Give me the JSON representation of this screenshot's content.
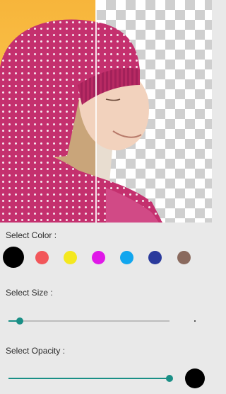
{
  "preview": {
    "original_background": "#f7b53b",
    "cutout_background": "transparent-checkerboard"
  },
  "color_section": {
    "label": "Select Color :",
    "selected_color": "#000000",
    "swatches": [
      {
        "name": "black",
        "hex": "#000000"
      },
      {
        "name": "red",
        "hex": "#f2565a"
      },
      {
        "name": "yellow",
        "hex": "#f4e81f"
      },
      {
        "name": "magenta",
        "hex": "#e018e8"
      },
      {
        "name": "sky-blue",
        "hex": "#12a6ee"
      },
      {
        "name": "indigo",
        "hex": "#2a3a9c"
      },
      {
        "name": "brown",
        "hex": "#8a6a5e"
      }
    ]
  },
  "size_section": {
    "label": "Select Size :",
    "value_fraction": 0.07
  },
  "opacity_section": {
    "label": "Select Opacity :",
    "value_fraction": 1.0,
    "preview_color": "#000000"
  },
  "colors": {
    "accent": "#1a8f86",
    "panel_background": "#e9e9e9"
  }
}
